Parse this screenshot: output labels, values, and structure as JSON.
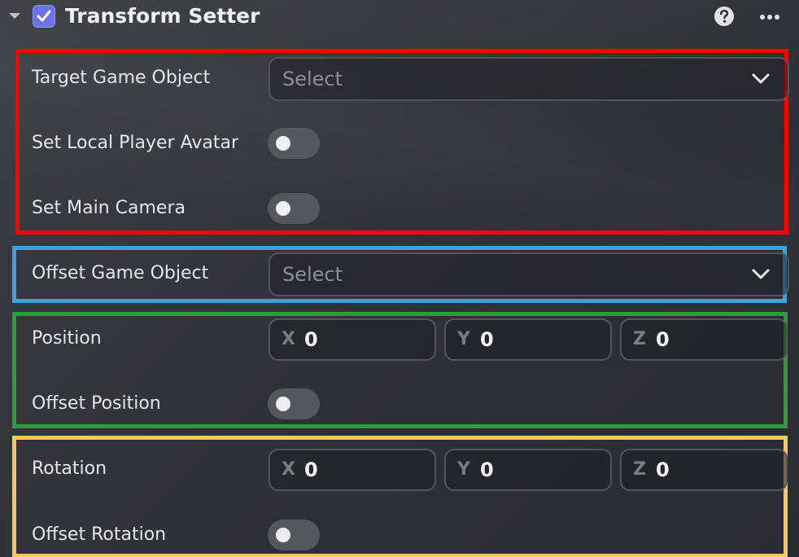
{
  "header": {
    "title": "Transform Setter",
    "enabled": true,
    "collapse_icon": "caret-down-icon",
    "checkbox_icon": "checkmark-icon",
    "help_icon": "help-icon",
    "more_icon": "more-icon"
  },
  "target": {
    "game_object_label": "Target Game Object",
    "game_object_placeholder": "Select",
    "local_player_label": "Set Local Player Avatar",
    "local_player_on": false,
    "main_camera_label": "Set Main Camera",
    "main_camera_on": false
  },
  "offset_object": {
    "label": "Offset Game Object",
    "placeholder": "Select"
  },
  "position": {
    "label": "Position",
    "x_axis": "X",
    "x": "0",
    "y_axis": "Y",
    "y": "0",
    "z_axis": "Z",
    "z": "0",
    "offset_label": "Offset Position",
    "offset_on": false
  },
  "rotation": {
    "label": "Rotation",
    "x_axis": "X",
    "x": "0",
    "y_axis": "Y",
    "y": "0",
    "z_axis": "Z",
    "z": "0",
    "offset_label": "Offset Rotation",
    "offset_on": false
  },
  "colors": {
    "checkbox": "#6a74e6",
    "section_target": "#ff0000",
    "section_offset_object": "#3ea2d8",
    "section_position": "#2f9a3e",
    "section_rotation": "#f4c863"
  }
}
